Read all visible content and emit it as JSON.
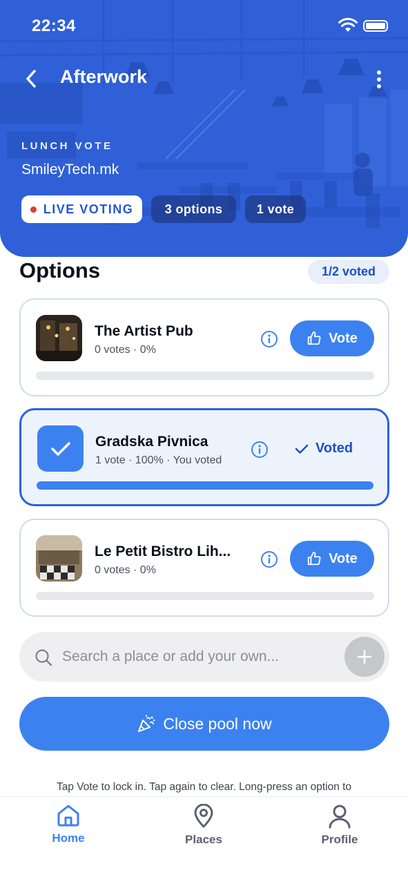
{
  "status_bar": {
    "time": "22:34"
  },
  "header": {
    "title": "Afterwork",
    "eyebrow": "LUNCH VOTE",
    "organization": "SmileyTech.mk",
    "chips": {
      "live": "LIVE VOTING",
      "options": "3 options",
      "votes": "1 vote"
    }
  },
  "options_section": {
    "title": "Options",
    "voted_badge": "1/2 voted",
    "items": [
      {
        "name": "The Artist Pub",
        "meta": "0 votes · 0%",
        "progress": 0,
        "action": "Vote",
        "selected": false
      },
      {
        "name": "Gradska Pivnica",
        "meta": "1 vote · 100% · You voted",
        "progress": 1.0,
        "action": "Voted",
        "selected": true
      },
      {
        "name": "Le Petit Bistro Lih...",
        "meta": "0 votes · 0%",
        "progress": 0,
        "action": "Vote",
        "selected": false
      }
    ]
  },
  "search": {
    "placeholder": "Search a place or add your own..."
  },
  "close_button": {
    "label": "Close pool now"
  },
  "hint": "Tap Vote to lock in. Tap again to clear. Long-press an option to",
  "tab_bar": {
    "items": [
      {
        "label": "Home",
        "icon": "home-icon",
        "active": true
      },
      {
        "label": "Places",
        "icon": "map-pin-icon",
        "active": false
      },
      {
        "label": "Profile",
        "icon": "user-icon",
        "active": false
      }
    ]
  },
  "colors": {
    "accent": "#3b82f0",
    "accent_dark": "#1f4fc4",
    "hero_tint": "#2f5fd6",
    "live_dot": "#e53935",
    "card_border": "#d5dbe5",
    "selected_border": "#2a62dc",
    "selected_bg": "#edf3fd"
  }
}
